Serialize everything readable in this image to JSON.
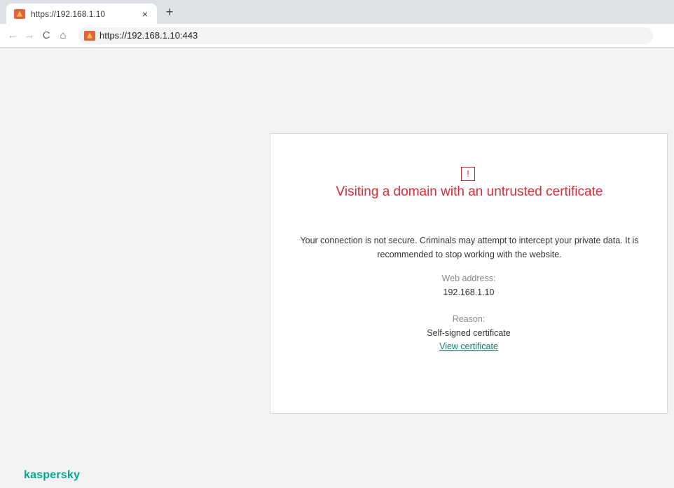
{
  "browser": {
    "tab_title": "https://192.168.1.10",
    "tab_close": "×",
    "new_tab": "+",
    "nav": {
      "back": "←",
      "forward": "→",
      "reload": "C",
      "home": "⌂"
    },
    "url": "https://192.168.1.10:443"
  },
  "warning": {
    "icon_glyph": "!",
    "title": "Visiting a domain with an untrusted certificate",
    "description": "Your connection is not secure. Criminals may attempt to intercept your private data. It is recommended to stop working with the website.",
    "web_address_label": "Web address:",
    "web_address": "192.168.1.10",
    "reason_label": "Reason:",
    "reason": "Self-signed certificate",
    "view_certificate": "View certificate"
  },
  "brand": {
    "logo": "kaspersky"
  },
  "colors": {
    "accent_red": "#dd2a35",
    "brand_green": "#00a88e",
    "link_green": "#167a6b"
  }
}
